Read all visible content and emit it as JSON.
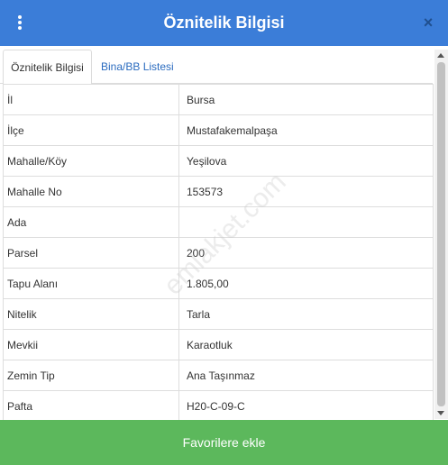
{
  "header": {
    "title": "Öznitelik Bilgisi",
    "menu_icon": "vertical-ellipsis-icon",
    "close_glyph": "×",
    "background_color": "#3b7dd8"
  },
  "tabs": [
    {
      "label": "Öznitelik Bilgisi",
      "active": true
    },
    {
      "label": "Bina/BB Listesi",
      "active": false
    }
  ],
  "attributes": [
    {
      "key": "İl",
      "value": "Bursa"
    },
    {
      "key": "İlçe",
      "value": "Mustafakemalpaşa"
    },
    {
      "key": "Mahalle/Köy",
      "value": "Yeşilova"
    },
    {
      "key": "Mahalle No",
      "value": "153573"
    },
    {
      "key": "Ada",
      "value": ""
    },
    {
      "key": "Parsel",
      "value": "200"
    },
    {
      "key": "Tapu Alanı",
      "value": "1.805,00"
    },
    {
      "key": "Nitelik",
      "value": "Tarla"
    },
    {
      "key": "Mevkii",
      "value": "Karaotluk"
    },
    {
      "key": "Zemin Tip",
      "value": "Ana Taşınmaz"
    },
    {
      "key": "Pafta",
      "value": "H20-C-09-C"
    }
  ],
  "watermark": "emlakjet.com",
  "footer": {
    "button_label": "Favorilere ekle",
    "color": "#5cb85c"
  }
}
